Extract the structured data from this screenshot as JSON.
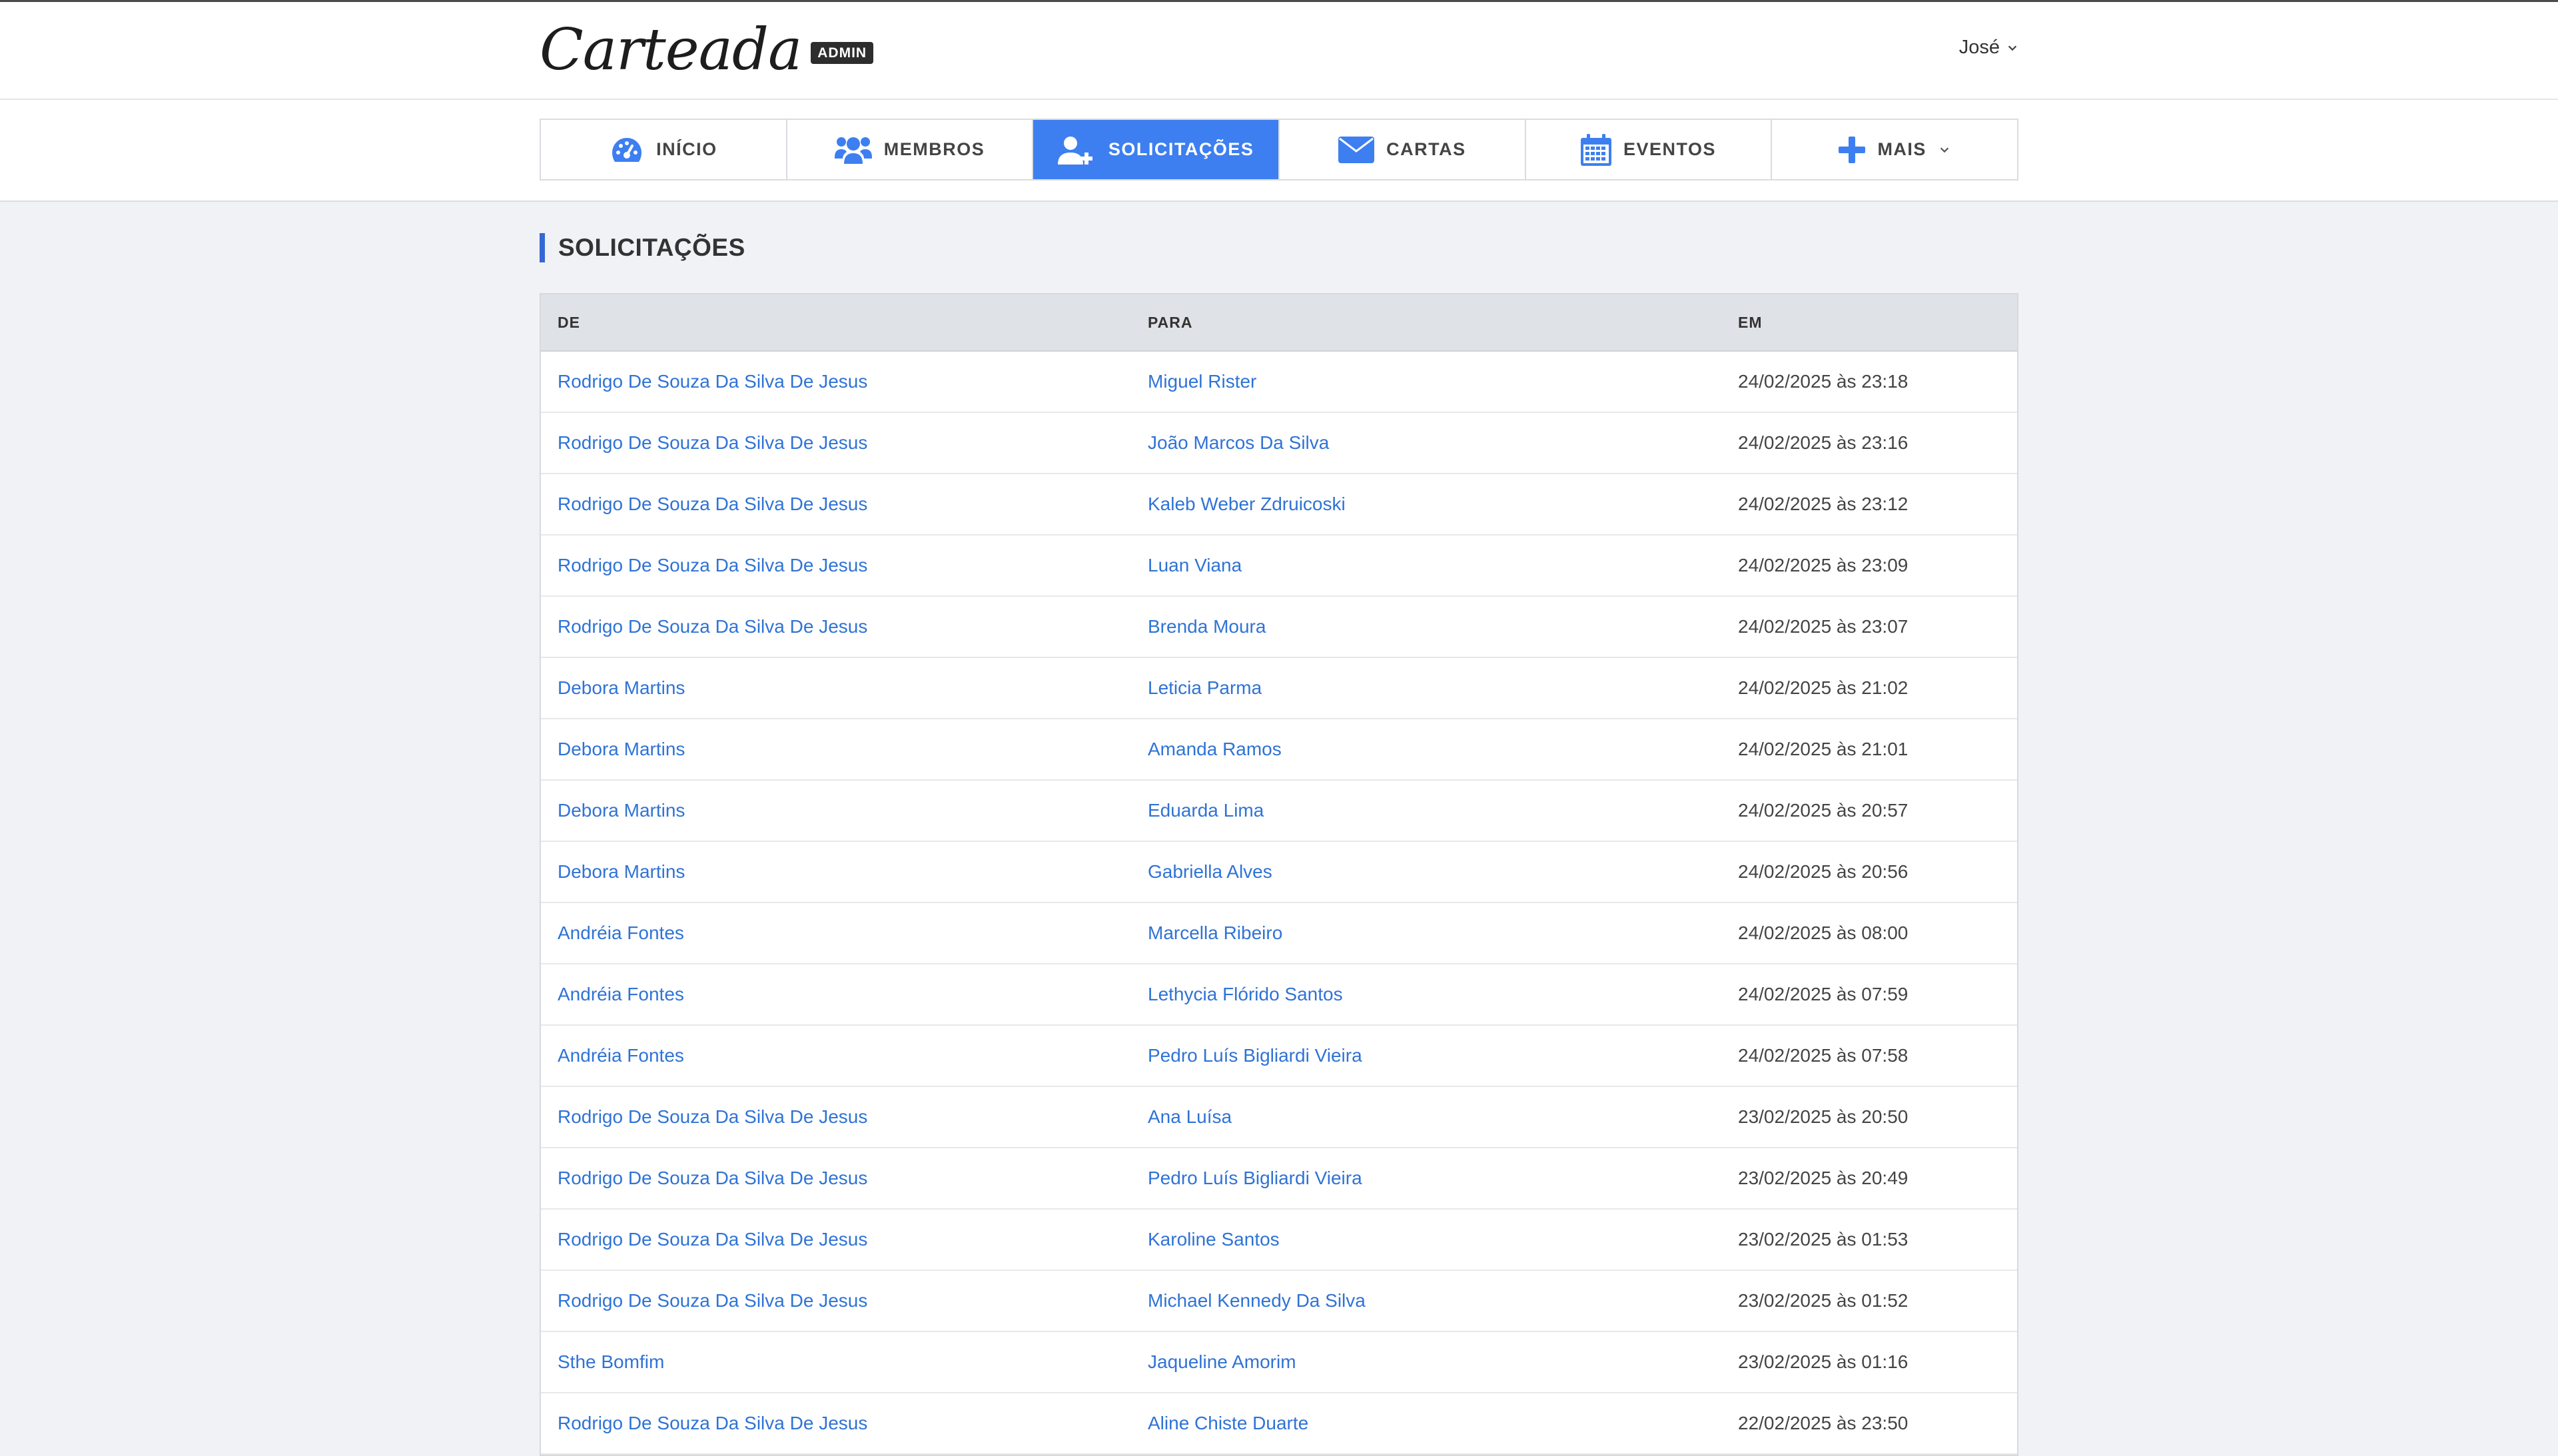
{
  "header": {
    "logo": "Carteada",
    "badge": "ADMIN",
    "user": "José"
  },
  "nav": {
    "tabs": [
      {
        "label": "INÍCIO",
        "icon": "dashboard-icon",
        "active": false
      },
      {
        "label": "MEMBROS",
        "icon": "users-icon",
        "active": false
      },
      {
        "label": "SOLICITAÇÕES",
        "icon": "user-plus-icon",
        "active": true
      },
      {
        "label": "CARTAS",
        "icon": "envelope-icon",
        "active": false
      },
      {
        "label": "EVENTOS",
        "icon": "calendar-icon",
        "active": false
      },
      {
        "label": "MAIS",
        "icon": "plus-icon",
        "active": false
      }
    ]
  },
  "page": {
    "title": "SOLICITAÇÕES"
  },
  "table": {
    "columns": [
      "DE",
      "PARA",
      "EM"
    ],
    "rows": [
      {
        "de": "Rodrigo De Souza Da Silva De Jesus",
        "para": "Miguel Rister",
        "em": "24/02/2025 às 23:18"
      },
      {
        "de": "Rodrigo De Souza Da Silva De Jesus",
        "para": "João Marcos Da Silva",
        "em": "24/02/2025 às 23:16"
      },
      {
        "de": "Rodrigo De Souza Da Silva De Jesus",
        "para": "Kaleb Weber Zdruicoski",
        "em": "24/02/2025 às 23:12"
      },
      {
        "de": "Rodrigo De Souza Da Silva De Jesus",
        "para": "Luan Viana",
        "em": "24/02/2025 às 23:09"
      },
      {
        "de": "Rodrigo De Souza Da Silva De Jesus",
        "para": "Brenda Moura",
        "em": "24/02/2025 às 23:07"
      },
      {
        "de": "Debora Martins",
        "para": "Leticia Parma",
        "em": "24/02/2025 às 21:02"
      },
      {
        "de": "Debora Martins",
        "para": "Amanda Ramos",
        "em": "24/02/2025 às 21:01"
      },
      {
        "de": "Debora Martins",
        "para": "Eduarda Lima",
        "em": "24/02/2025 às 20:57"
      },
      {
        "de": "Debora Martins",
        "para": "Gabriella Alves",
        "em": "24/02/2025 às 20:56"
      },
      {
        "de": "Andréia Fontes",
        "para": "Marcella Ribeiro",
        "em": "24/02/2025 às 08:00"
      },
      {
        "de": "Andréia Fontes",
        "para": "Lethycia Flórido Santos",
        "em": "24/02/2025 às 07:59"
      },
      {
        "de": "Andréia Fontes",
        "para": "Pedro Luís Bigliardi Vieira",
        "em": "24/02/2025 às 07:58"
      },
      {
        "de": "Rodrigo De Souza Da Silva De Jesus",
        "para": "Ana Luísa",
        "em": "23/02/2025 às 20:50"
      },
      {
        "de": "Rodrigo De Souza Da Silva De Jesus",
        "para": "Pedro Luís Bigliardi Vieira",
        "em": "23/02/2025 às 20:49"
      },
      {
        "de": "Rodrigo De Souza Da Silva De Jesus",
        "para": "Karoline Santos",
        "em": "23/02/2025 às 01:53"
      },
      {
        "de": "Rodrigo De Souza Da Silva De Jesus",
        "para": "Michael Kennedy Da Silva",
        "em": "23/02/2025 às 01:52"
      },
      {
        "de": "Sthe Bomfim",
        "para": "Jaqueline Amorim",
        "em": "23/02/2025 às 01:16"
      },
      {
        "de": "Rodrigo De Souza Da Silva De Jesus",
        "para": "Aline Chiste Duarte",
        "em": "22/02/2025 às 23:50"
      }
    ]
  },
  "colors": {
    "accent": "#3d7ff0",
    "link": "#2f73d6",
    "title_bar": "#3568d4",
    "page_bg": "#f0f2f5"
  }
}
